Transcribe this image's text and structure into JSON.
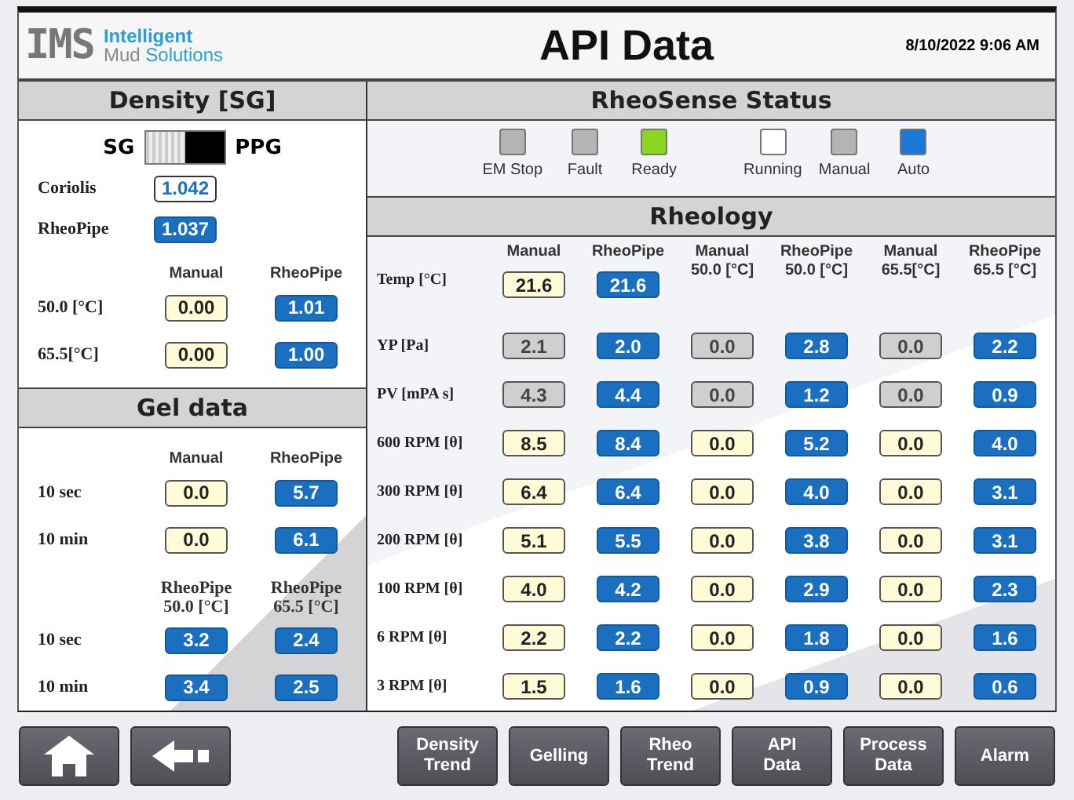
{
  "header": {
    "logo_mark": "IMS",
    "logo_line1": "Intelligent",
    "logo_line2a": "Mud",
    "logo_line2b": "Solutions",
    "title": "API Data",
    "datetime": "8/10/2022 9:06 AM"
  },
  "density": {
    "title": "Density [SG]",
    "unit_left": "SG",
    "unit_right": "PPG",
    "toggle_right": true,
    "readings": [
      {
        "label": "Coriolis",
        "value": "1.042",
        "kind": "display"
      },
      {
        "label": "RheoPipe",
        "value": "1.037",
        "kind": "readout"
      }
    ],
    "columns": [
      "Manual",
      "RheoPipe"
    ],
    "rows": [
      {
        "label": "50.0 [°C]",
        "cells": [
          {
            "value": "0.00",
            "kind": "input"
          },
          {
            "value": "1.01",
            "kind": "readout"
          }
        ]
      },
      {
        "label": "65.5[°C]",
        "cells": [
          {
            "value": "0.00",
            "kind": "input"
          },
          {
            "value": "1.00",
            "kind": "readout"
          }
        ]
      }
    ]
  },
  "gel": {
    "title": "Gel data",
    "columns": [
      "Manual",
      "RheoPipe"
    ],
    "rows": [
      {
        "label": "10 sec",
        "cells": [
          {
            "value": "0.0",
            "kind": "input"
          },
          {
            "value": "5.7",
            "kind": "readout"
          }
        ]
      },
      {
        "label": "10 min",
        "cells": [
          {
            "value": "0.0",
            "kind": "input"
          },
          {
            "value": "6.1",
            "kind": "readout"
          }
        ]
      }
    ],
    "columns2": [
      "RheoPipe\n50.0 [°C]",
      "RheoPipe\n65.5 [°C]"
    ],
    "rows2": [
      {
        "label": "10 sec",
        "cells": [
          {
            "value": "3.2",
            "kind": "readout"
          },
          {
            "value": "2.4",
            "kind": "readout"
          }
        ]
      },
      {
        "label": "10 min",
        "cells": [
          {
            "value": "3.4",
            "kind": "readout"
          },
          {
            "value": "2.5",
            "kind": "readout"
          }
        ]
      }
    ]
  },
  "status": {
    "title": "RheoSense Status",
    "lamp_groups": [
      [
        {
          "label": "EM Stop",
          "color": "#b4b4b4"
        },
        {
          "label": "Fault",
          "color": "#b4b4b4"
        },
        {
          "label": "Ready",
          "color": "#8cd422"
        }
      ],
      [
        {
          "label": "Running",
          "color": "#ffffff"
        },
        {
          "label": "Manual",
          "color": "#b4b4b4"
        },
        {
          "label": "Auto",
          "color": "#1a78d8"
        }
      ]
    ]
  },
  "rheology": {
    "title": "Rheology",
    "columns": [
      "Manual",
      "RheoPipe",
      "Manual\n50.0 [°C]",
      "RheoPipe\n50.0 [°C]",
      "Manual\n65.5[°C]",
      "RheoPipe\n65.5 [°C]"
    ],
    "rows": [
      {
        "label": "Temp [°C]",
        "cells": [
          {
            "value": "21.6",
            "kind": "input"
          },
          {
            "value": "21.6",
            "kind": "readout"
          }
        ]
      },
      {
        "label": "YP [Pa]",
        "cells": [
          {
            "value": "2.1",
            "kind": "calc"
          },
          {
            "value": "2.0",
            "kind": "readout"
          },
          {
            "value": "0.0",
            "kind": "calc"
          },
          {
            "value": "2.8",
            "kind": "readout"
          },
          {
            "value": "0.0",
            "kind": "calc"
          },
          {
            "value": "2.2",
            "kind": "readout"
          }
        ]
      },
      {
        "label": "PV [mPA s]",
        "cells": [
          {
            "value": "4.3",
            "kind": "calc"
          },
          {
            "value": "4.4",
            "kind": "readout"
          },
          {
            "value": "0.0",
            "kind": "calc"
          },
          {
            "value": "1.2",
            "kind": "readout"
          },
          {
            "value": "0.0",
            "kind": "calc"
          },
          {
            "value": "0.9",
            "kind": "readout"
          }
        ]
      },
      {
        "label": "600 RPM [θ]",
        "cells": [
          {
            "value": "8.5",
            "kind": "input"
          },
          {
            "value": "8.4",
            "kind": "readout"
          },
          {
            "value": "0.0",
            "kind": "input"
          },
          {
            "value": "5.2",
            "kind": "readout"
          },
          {
            "value": "0.0",
            "kind": "input"
          },
          {
            "value": "4.0",
            "kind": "readout"
          }
        ]
      },
      {
        "label": "300 RPM [θ]",
        "cells": [
          {
            "value": "6.4",
            "kind": "input"
          },
          {
            "value": "6.4",
            "kind": "readout"
          },
          {
            "value": "0.0",
            "kind": "input"
          },
          {
            "value": "4.0",
            "kind": "readout"
          },
          {
            "value": "0.0",
            "kind": "input"
          },
          {
            "value": "3.1",
            "kind": "readout"
          }
        ]
      },
      {
        "label": "200 RPM [θ]",
        "cells": [
          {
            "value": "5.1",
            "kind": "input"
          },
          {
            "value": "5.5",
            "kind": "readout"
          },
          {
            "value": "0.0",
            "kind": "input"
          },
          {
            "value": "3.8",
            "kind": "readout"
          },
          {
            "value": "0.0",
            "kind": "input"
          },
          {
            "value": "3.1",
            "kind": "readout"
          }
        ]
      },
      {
        "label": "100 RPM [θ]",
        "cells": [
          {
            "value": "4.0",
            "kind": "input"
          },
          {
            "value": "4.2",
            "kind": "readout"
          },
          {
            "value": "0.0",
            "kind": "input"
          },
          {
            "value": "2.9",
            "kind": "readout"
          },
          {
            "value": "0.0",
            "kind": "input"
          },
          {
            "value": "2.3",
            "kind": "readout"
          }
        ]
      },
      {
        "label": "6 RPM [θ]",
        "cells": [
          {
            "value": "2.2",
            "kind": "input"
          },
          {
            "value": "2.2",
            "kind": "readout"
          },
          {
            "value": "0.0",
            "kind": "input"
          },
          {
            "value": "1.8",
            "kind": "readout"
          },
          {
            "value": "0.0",
            "kind": "input"
          },
          {
            "value": "1.6",
            "kind": "readout"
          }
        ]
      },
      {
        "label": "3 RPM [θ]",
        "cells": [
          {
            "value": "1.5",
            "kind": "input"
          },
          {
            "value": "1.6",
            "kind": "readout"
          },
          {
            "value": "0.0",
            "kind": "input"
          },
          {
            "value": "0.9",
            "kind": "readout"
          },
          {
            "value": "0.0",
            "kind": "input"
          },
          {
            "value": "0.6",
            "kind": "readout"
          }
        ]
      }
    ]
  },
  "nav": {
    "icon_buttons": [
      {
        "kind": "home"
      },
      {
        "kind": "back"
      }
    ],
    "buttons": [
      [
        "Density",
        "Trend"
      ],
      [
        "Gelling"
      ],
      [
        "Rheo",
        "Trend"
      ],
      [
        "API",
        "Data"
      ],
      [
        "Process",
        "Data"
      ],
      [
        "Alarm"
      ]
    ]
  }
}
